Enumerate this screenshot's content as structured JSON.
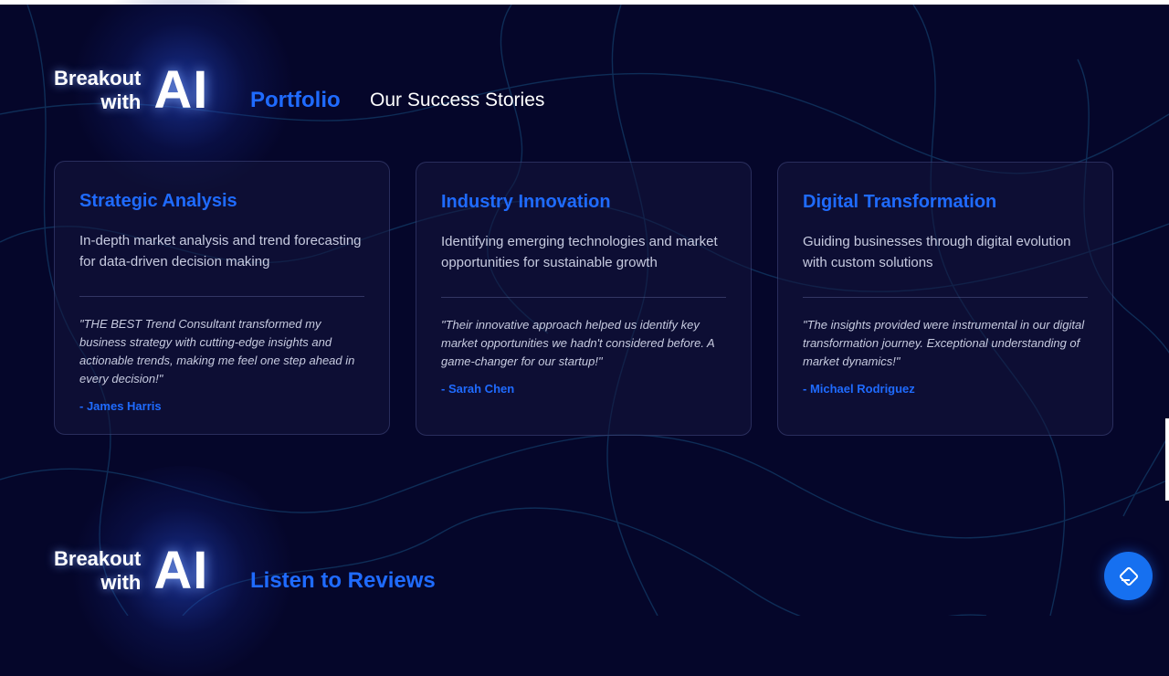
{
  "logo": {
    "line1": "Breakout",
    "line2": "with",
    "ai": "AI"
  },
  "portfolio": {
    "tag": "Portfolio",
    "subtitle": "Our Success Stories"
  },
  "cards": [
    {
      "title": "Strategic Analysis",
      "desc": "In-depth market analysis and trend forecasting for data-driven decision making",
      "quote": "\"THE BEST Trend Consultant transformed my business strategy with cutting-edge insights and actionable trends, making me feel one step ahead in every decision!\"",
      "author": "- James Harris"
    },
    {
      "title": "Industry Innovation",
      "desc": "Identifying emerging technologies and market opportunities for sustainable growth",
      "quote": "\"Their innovative approach helped us identify key market opportunities we hadn't considered before. A game-changer for our startup!\"",
      "author": "- Sarah Chen"
    },
    {
      "title": "Digital Transformation",
      "desc": "Guiding businesses through digital evolution with custom solutions",
      "quote": "\"The insights provided were instrumental in our digital transformation journey. Exceptional understanding of market dynamics!\"",
      "author": "- Michael Rodriguez"
    }
  ],
  "reviews": {
    "tag": "Listen to Reviews"
  },
  "fab": {
    "icon": "diamond-outline-icon"
  },
  "colors": {
    "background": "#05062a",
    "accent": "#1f6bff",
    "fab": "#1670f0"
  }
}
